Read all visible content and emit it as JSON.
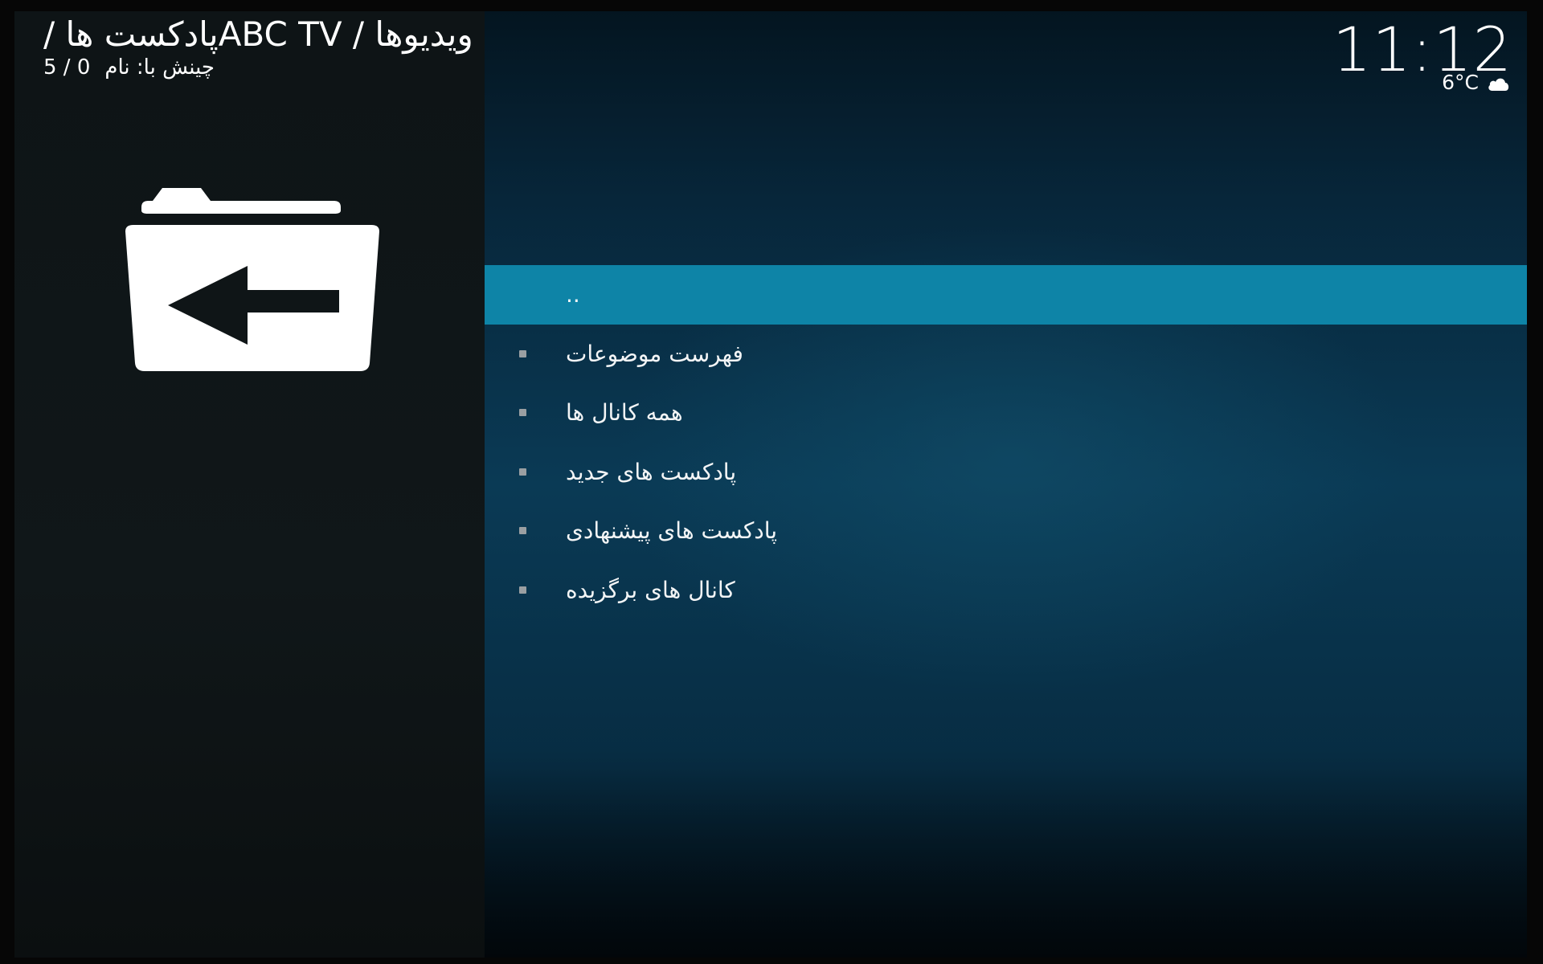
{
  "header": {
    "breadcrumb": "ویدیوها / ABC TVپادکست ها /",
    "sort_label": "چینش با: نام",
    "item_counter": "5 / 0"
  },
  "status": {
    "clock": "11:12",
    "temperature": "6°C",
    "weather_icon": "cloud-icon"
  },
  "side_panel": {
    "icon": "folder-back-icon"
  },
  "list": {
    "items": [
      {
        "label": "..",
        "selected": true
      },
      {
        "label": "فهرست موضوعات",
        "selected": false
      },
      {
        "label": "همه کانال ها",
        "selected": false
      },
      {
        "label": "پادکست های جدید",
        "selected": false
      },
      {
        "label": "پادکست های پیشنهادی",
        "selected": false
      },
      {
        "label": "کانال های برگزیده",
        "selected": false
      }
    ]
  },
  "colors": {
    "selection": "#0e84a7",
    "background_teal": "#0a3a55",
    "side_panel": "#101719"
  }
}
